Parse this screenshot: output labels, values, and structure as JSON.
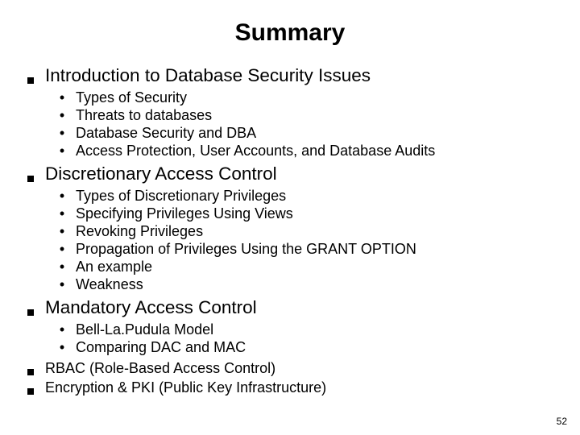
{
  "title": "Summary",
  "page_number": "52",
  "sections": [
    {
      "label": "Introduction to Database Security Issues",
      "small": false,
      "items": [
        "Types of Security",
        "Threats to databases",
        "Database Security and DBA",
        "Access Protection, User Accounts, and Database Audits"
      ]
    },
    {
      "label": "Discretionary Access Control",
      "small": false,
      "items": [
        "Types of Discretionary Privileges",
        "Specifying Privileges Using Views",
        "Revoking Privileges",
        "Propagation of Privileges Using the GRANT OPTION",
        "An example",
        "Weakness"
      ]
    },
    {
      "label": "Mandatory Access Control",
      "small": false,
      "items": [
        "Bell-La.Pudula Model",
        "Comparing DAC and MAC"
      ]
    },
    {
      "label": "RBAC (Role-Based Access Control)",
      "small": true,
      "items": []
    },
    {
      "label": "Encryption & PKI (Public Key Infrastructure)",
      "small": true,
      "items": []
    }
  ]
}
